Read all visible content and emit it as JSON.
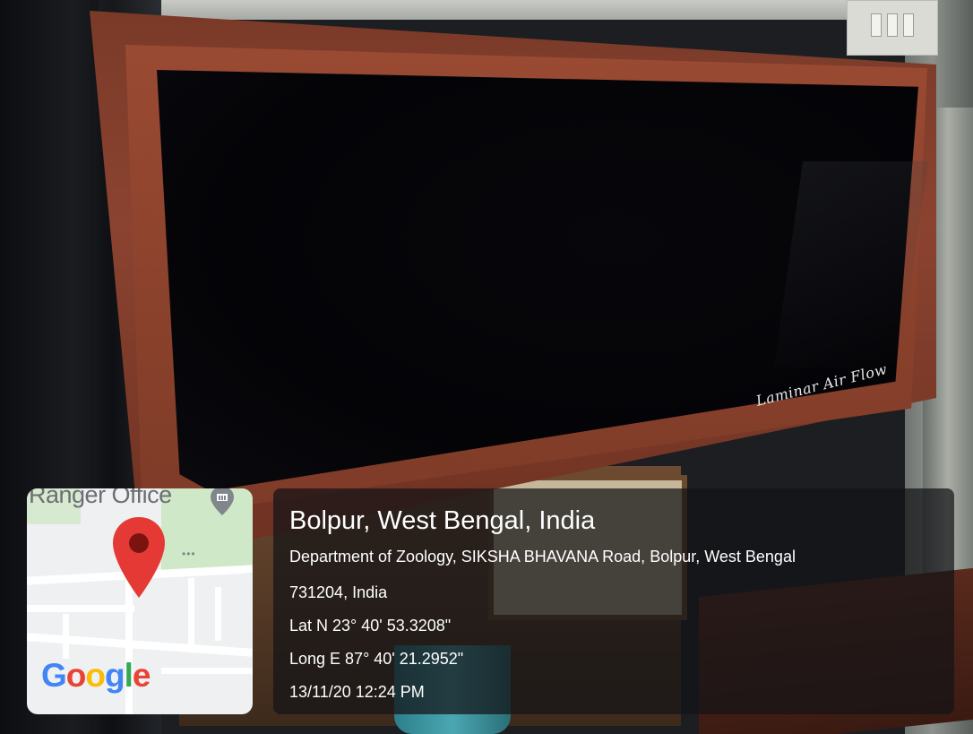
{
  "photo": {
    "cabinet_script": "Laminar Air Flow"
  },
  "map_card": {
    "place_label": "Ranger Office",
    "logo_letters": [
      {
        "char": "G",
        "color": "#4285F4"
      },
      {
        "char": "o",
        "color": "#EA4335"
      },
      {
        "char": "o",
        "color": "#FBBC05"
      },
      {
        "char": "g",
        "color": "#4285F4"
      },
      {
        "char": "l",
        "color": "#34A853"
      },
      {
        "char": "e",
        "color": "#EA4335"
      }
    ],
    "pin_color": "#E53935",
    "marker_icon": "location-pin-icon",
    "poi_icon": "building-pin-icon"
  },
  "info": {
    "title": "Bolpur, West Bengal, India",
    "address_line1": "Department of Zoology, SIKSHA BHAVANA Road, Bolpur, West Bengal",
    "address_line2": "731204, India",
    "latitude": "Lat N 23° 40' 53.3208\"",
    "longitude": "Long E 87° 40' 21.2952\"",
    "timestamp": "13/11/20 12:24 PM"
  }
}
